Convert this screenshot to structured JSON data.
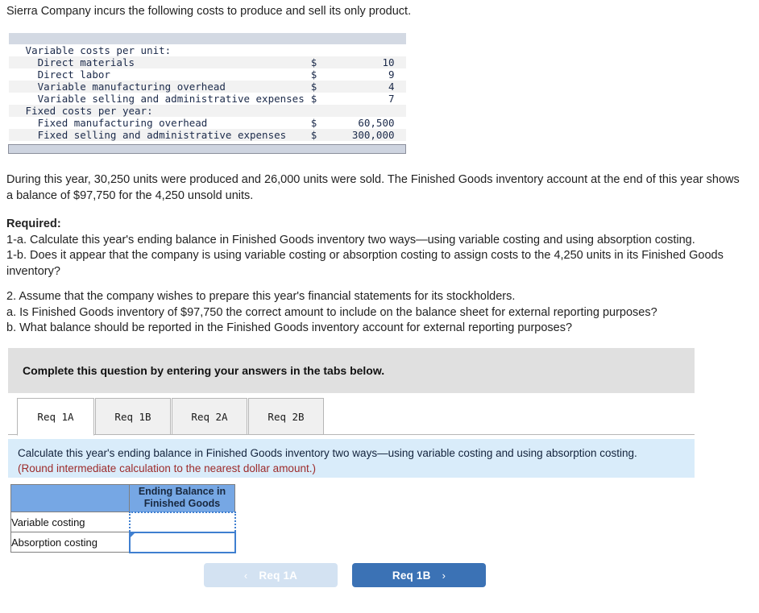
{
  "intro": "Sierra Company incurs the following costs to produce and sell its only product.",
  "cost_table": {
    "rows": [
      {
        "label": "Variable costs per unit:",
        "currency": "",
        "value": "",
        "indent": 1,
        "shade": false
      },
      {
        "label": "Direct materials",
        "currency": "$",
        "value": "10",
        "indent": 2,
        "shade": true
      },
      {
        "label": "Direct labor",
        "currency": "$",
        "value": "9",
        "indent": 2,
        "shade": false
      },
      {
        "label": "Variable manufacturing overhead",
        "currency": "$",
        "value": "4",
        "indent": 2,
        "shade": true
      },
      {
        "label": "Variable selling and administrative expenses",
        "currency": "$",
        "value": "7",
        "indent": 2,
        "shade": false
      },
      {
        "label": "Fixed costs per year:",
        "currency": "",
        "value": "",
        "indent": 1,
        "shade": true
      },
      {
        "label": "Fixed manufacturing overhead",
        "currency": "$",
        "value": "60,500",
        "indent": 2,
        "shade": false
      },
      {
        "label": "Fixed selling and administrative expenses",
        "currency": "$",
        "value": "300,000",
        "indent": 2,
        "shade": true
      }
    ]
  },
  "during_paragraph": "During this year, 30,250 units were produced and 26,000 units were sold. The Finished Goods inventory account at the end of this year shows a balance of $97,750 for the 4,250 unsold units.",
  "required": {
    "heading": "Required:",
    "line_1a": "1-a. Calculate this year's ending balance in Finished Goods inventory two ways—using variable costing and using absorption costing.",
    "line_1b": "1-b. Does it appear that the company is using variable costing or absorption costing to assign costs to the 4,250 units in its Finished Goods inventory?"
  },
  "question_two": {
    "line_2": "2. Assume that the company wishes to prepare this year's financial statements for its stockholders.",
    "line_a": "a. Is Finished Goods inventory of $97,750 the correct amount to include on the balance sheet for external reporting purposes?",
    "line_b": "b. What balance should be reported in the Finished Goods inventory account for external reporting purposes?"
  },
  "banner": {
    "text": "Complete this question by entering your answers in the tabs below."
  },
  "tabs": [
    {
      "label": "Req 1A",
      "active": true
    },
    {
      "label": "Req 1B",
      "active": false
    },
    {
      "label": "Req 2A",
      "active": false
    },
    {
      "label": "Req 2B",
      "active": false
    }
  ],
  "blue_panel": {
    "text": "Calculate this year's ending balance in Finished Goods inventory two ways—using variable costing and using absorption costing. ",
    "hint": "(Round intermediate calculation to the nearest dollar amount.)"
  },
  "answer_table": {
    "corner_label": "",
    "column_header": "Ending Balance in Finished Goods",
    "rows": [
      {
        "label": "Variable costing",
        "value": "",
        "placeholder": "",
        "selection": "dotted"
      },
      {
        "label": "Absorption costing",
        "value": "",
        "placeholder": "",
        "selection": "solid"
      }
    ]
  },
  "nav": {
    "prev_label": "Req 1A",
    "prev_chevron": "‹",
    "next_label": "Req 1B",
    "next_chevron": "›"
  },
  "colors": {
    "table_header_bar": "#d3d9e3",
    "table_stripe": "#f2f2f2",
    "banner_gray": "#e0e0e0",
    "panel_blue": "#d9ecfa",
    "accent_blue": "#76a7e4",
    "button_blue": "#3b72b5",
    "button_disabled": "#d3e2f2",
    "hint_red": "#9d2b2b",
    "selection_blue": "#3f7fd0"
  }
}
